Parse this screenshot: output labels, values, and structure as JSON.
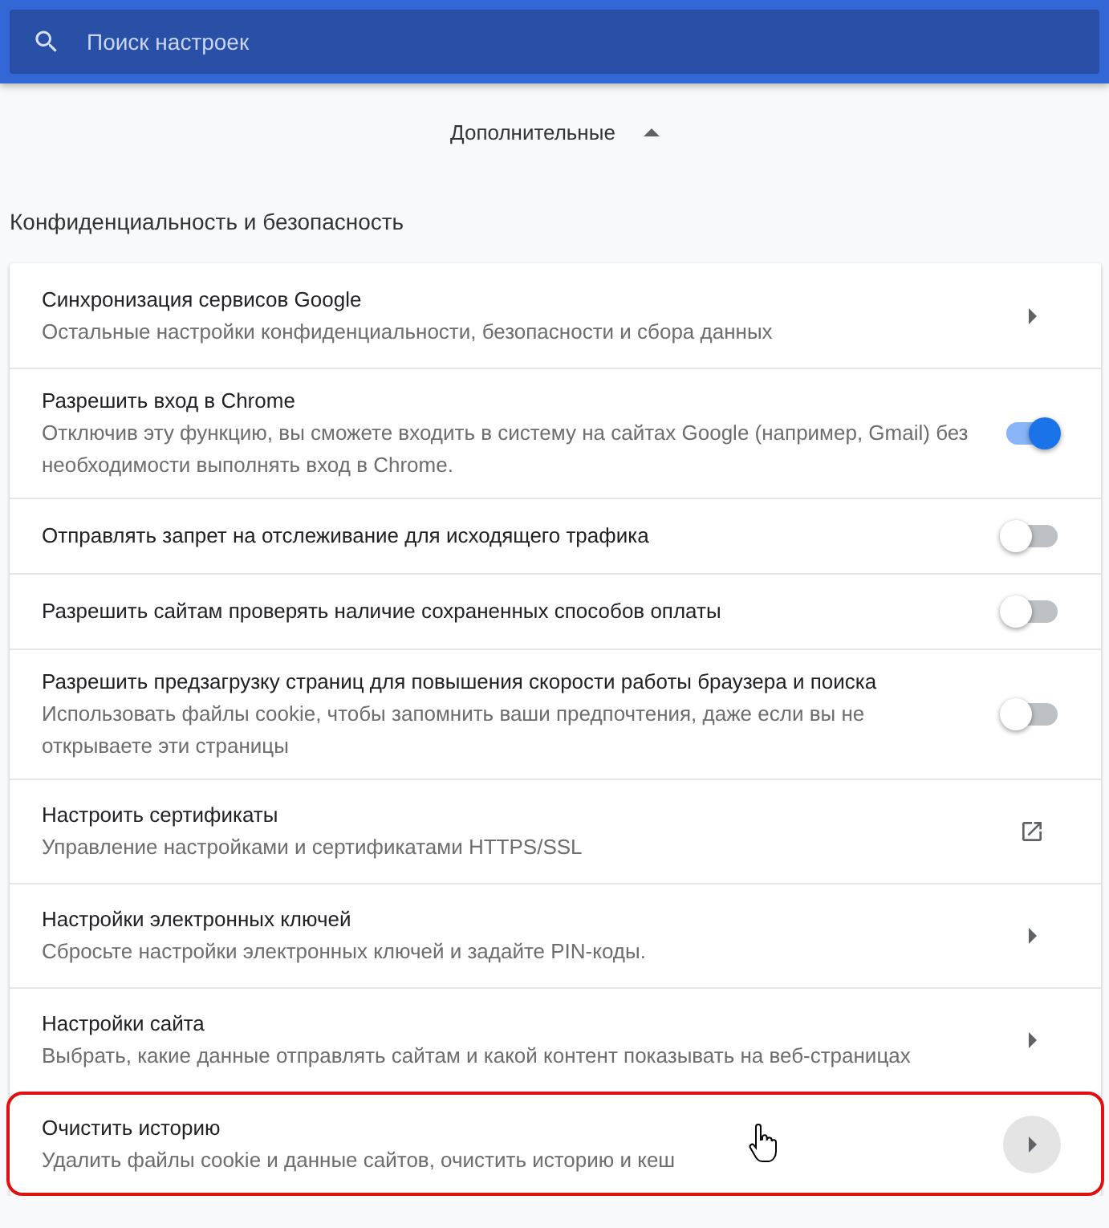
{
  "search": {
    "placeholder": "Поиск настроек"
  },
  "advanced": {
    "label": "Дополнительные",
    "expanded": true
  },
  "section_title": "Конфиденциальность и безопасность",
  "rows": [
    {
      "kind": "arrow",
      "title": "Синхронизация сервисов Google",
      "subtitle": "Остальные настройки конфиденциальности, безопасности и сбора данных",
      "highlighted": false,
      "hovered": false
    },
    {
      "kind": "toggle",
      "title": "Разрешить вход в Chrome",
      "subtitle": "Отключив эту функцию, вы сможете входить в систему на сайтах Google (например, Gmail) без необходимости выполнять вход в Chrome.",
      "on": true,
      "highlighted": false,
      "hovered": false
    },
    {
      "kind": "toggle",
      "title": "Отправлять запрет на отслеживание для исходящего трафика",
      "on": false,
      "highlighted": false,
      "hovered": false
    },
    {
      "kind": "toggle",
      "title": "Разрешить сайтам проверять наличие сохраненных способов оплаты",
      "on": false,
      "highlighted": false,
      "hovered": false
    },
    {
      "kind": "toggle",
      "title": "Разрешить предзагрузку страниц для повышения скорости работы браузера и поиска",
      "subtitle": "Использовать файлы cookie, чтобы запомнить ваши предпочтения, даже если вы не открываете эти страницы",
      "on": false,
      "highlighted": false,
      "hovered": false
    },
    {
      "kind": "external",
      "title": "Настроить сертификаты",
      "subtitle": "Управление настройками и сертификатами HTTPS/SSL",
      "highlighted": false,
      "hovered": false
    },
    {
      "kind": "arrow",
      "title": "Настройки электронных ключей",
      "subtitle": "Сбросьте настройки электронных ключей и задайте PIN-коды.",
      "highlighted": false,
      "hovered": false
    },
    {
      "kind": "arrow",
      "title": "Настройки сайта",
      "subtitle": "Выбрать, какие данные отправлять сайтам и какой контент показывать на веб-страницах",
      "highlighted": false,
      "hovered": false
    },
    {
      "kind": "arrow",
      "title": "Очистить историю",
      "subtitle": "Удалить файлы cookie и данные сайтов, очистить историю и кеш",
      "highlighted": true,
      "hovered": true
    }
  ]
}
